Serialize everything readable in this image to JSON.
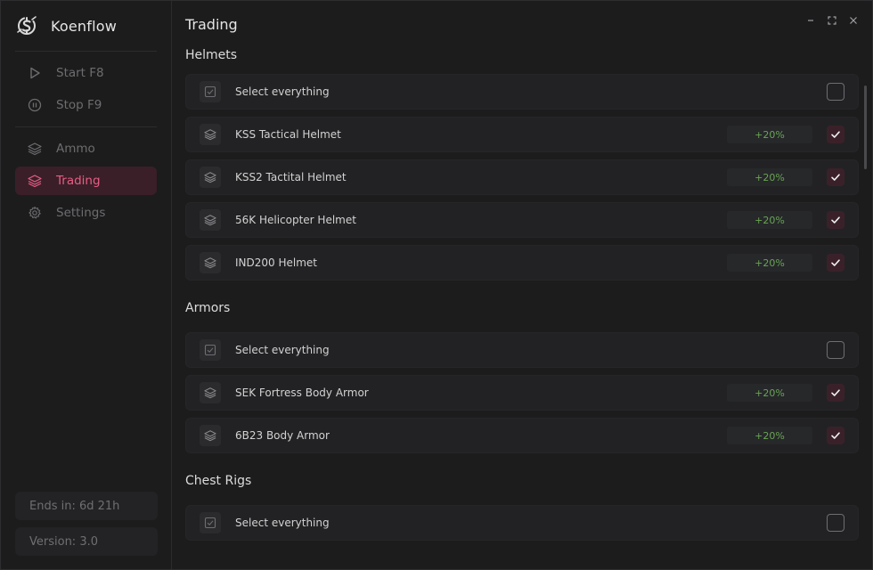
{
  "app": {
    "name": "Koenflow",
    "logo_icon": "koenflow-logo-icon",
    "accent_color": "#e85d86"
  },
  "sidebar": {
    "controls": [
      {
        "label": "Start F8",
        "icon": "play-icon"
      },
      {
        "label": "Stop F9",
        "icon": "pause-circle-icon"
      }
    ],
    "nav": [
      {
        "label": "Ammo",
        "icon": "layers-icon",
        "active": false
      },
      {
        "label": "Trading",
        "icon": "layers-icon",
        "active": true
      },
      {
        "label": "Settings",
        "icon": "gear-icon",
        "active": false
      }
    ],
    "ends_in": "Ends in: 6d 21h",
    "version": "Version: 3.0"
  },
  "main": {
    "title": "Trading",
    "sections": [
      {
        "title": "Helmets",
        "select_all_label": "Select everything",
        "select_all_checked": false,
        "items": [
          {
            "label": "KSS Tactical Helmet",
            "bonus": "+20%",
            "checked": true
          },
          {
            "label": "KSS2 Tactital Helmet",
            "bonus": "+20%",
            "checked": true
          },
          {
            "label": "56K Helicopter Helmet",
            "bonus": "+20%",
            "checked": true
          },
          {
            "label": "IND200 Helmet",
            "bonus": "+20%",
            "checked": true
          }
        ]
      },
      {
        "title": "Armors",
        "select_all_label": "Select everything",
        "select_all_checked": false,
        "items": [
          {
            "label": "SEK Fortress Body Armor",
            "bonus": "+20%",
            "checked": true
          },
          {
            "label": "6B23 Body Armor",
            "bonus": "+20%",
            "checked": true
          }
        ]
      },
      {
        "title": "Chest Rigs",
        "select_all_label": "Select everything",
        "select_all_checked": false,
        "items": []
      }
    ]
  }
}
